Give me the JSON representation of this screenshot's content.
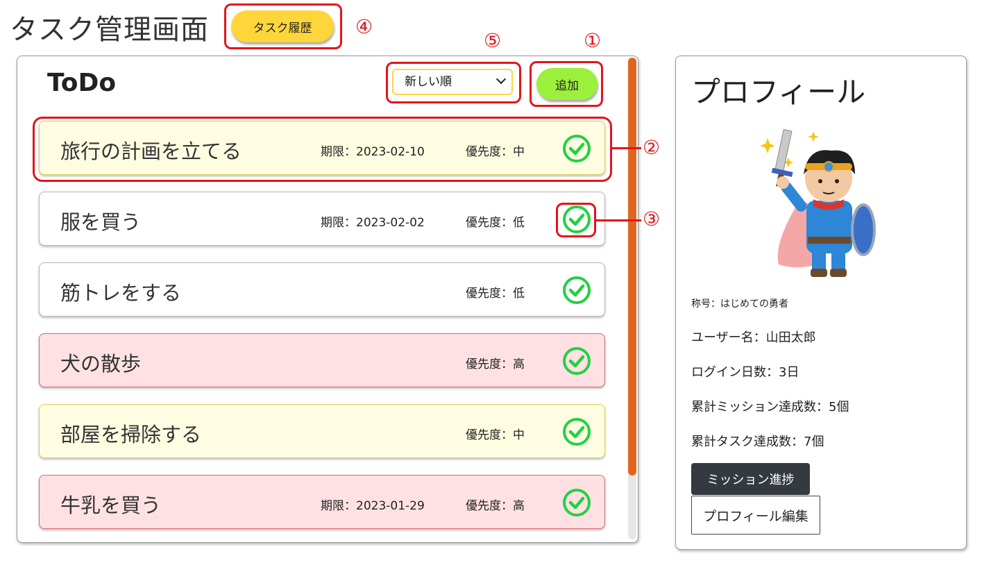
{
  "header": {
    "title": "タスク管理画面",
    "history_button": "タスク履歴"
  },
  "annotations": [
    "①",
    "②",
    "③",
    "④",
    "⑤"
  ],
  "todo": {
    "title": "ToDo",
    "sort_selected": "新しい順",
    "add_button": "追加",
    "tasks": [
      {
        "name": "旅行の計画を立てる",
        "due": "期限：2023-02-10",
        "priority": "優先度：中",
        "level": "中"
      },
      {
        "name": "服を買う",
        "due": "期限：2023-02-02",
        "priority": "優先度：低",
        "level": "低"
      },
      {
        "name": "筋トレをする",
        "due": "",
        "priority": "優先度：低",
        "level": "低"
      },
      {
        "name": "犬の散歩",
        "due": "",
        "priority": "優先度：高",
        "level": "高"
      },
      {
        "name": "部屋を掃除する",
        "due": "",
        "priority": "優先度：中",
        "level": "中"
      },
      {
        "name": "牛乳を買う",
        "due": "期限：2023-01-29",
        "priority": "優先度：高",
        "level": "高"
      }
    ],
    "check_icon": "check-circle-icon"
  },
  "profile": {
    "title": "プロフィール",
    "avatar_icon": "hero-avatar-icon",
    "rank": "称号：はじめての勇者",
    "username": "ユーザー名：山田太郎",
    "login_days": "ログイン日数：3日",
    "missions_done": "累計ミッション達成数：5個",
    "tasks_done": "累計タスク達成数：7個",
    "mission_button": "ミッション進捗",
    "edit_button": "プロフィール編集"
  },
  "colors": {
    "annotation": "#e3141b",
    "history_button": "#ffd63a",
    "add_button": "#9cf03c",
    "scrollbar": "#e0661f",
    "check": "#22d142",
    "priority_mid_bg": "#fffde1",
    "priority_high_bg": "#ffe1e3"
  }
}
